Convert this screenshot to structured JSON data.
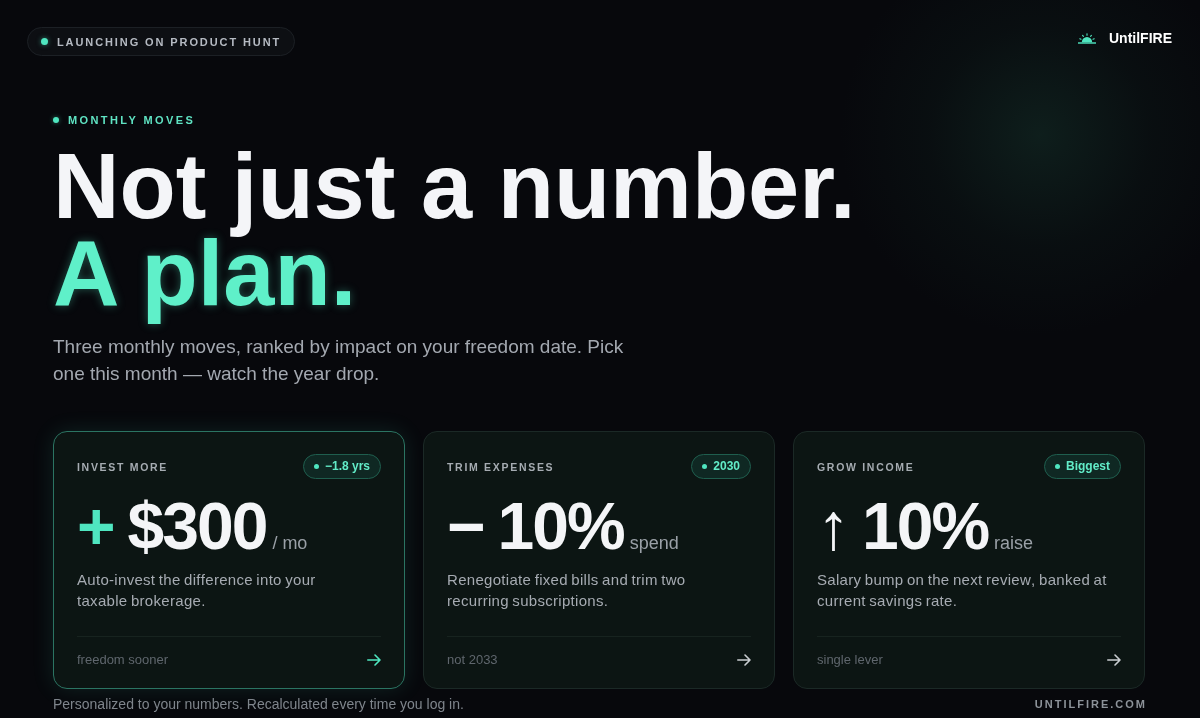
{
  "launch_pill": {
    "label": "LAUNCHING ON PRODUCT HUNT"
  },
  "brand": {
    "name": "UntilFIRE"
  },
  "hero": {
    "eyebrow": "MONTHLY MOVES",
    "headline": "Not just a number.",
    "headline_accent": "A plan.",
    "subtitle": "Three monthly moves, ranked by impact on your freedom date. Pick one this month — watch the year drop."
  },
  "cards": [
    {
      "label": "INVEST MORE",
      "badge": "−1.8 yrs",
      "sign": "+",
      "value": "$300",
      "unit": "/ mo",
      "description": "Auto-invest the difference into your taxable brokerage.",
      "footnote": "freedom sooner",
      "selected": true
    },
    {
      "label": "TRIM EXPENSES",
      "badge": "2030",
      "sign": "−",
      "value": "10%",
      "unit": "spend",
      "description": "Renegotiate fixed bills and trim two recurring subscriptions.",
      "footnote": "not 2033",
      "selected": false
    },
    {
      "label": "GROW INCOME",
      "badge": "Biggest",
      "sign": "↑",
      "value": "10%",
      "unit": "raise",
      "description": "Salary bump on the next review, banked at current savings rate.",
      "footnote": "single lever",
      "selected": false
    }
  ],
  "footer": {
    "note": "Personalized to your numbers. Recalculated every time you log in.",
    "site": "UNTILFIRE.COM"
  }
}
